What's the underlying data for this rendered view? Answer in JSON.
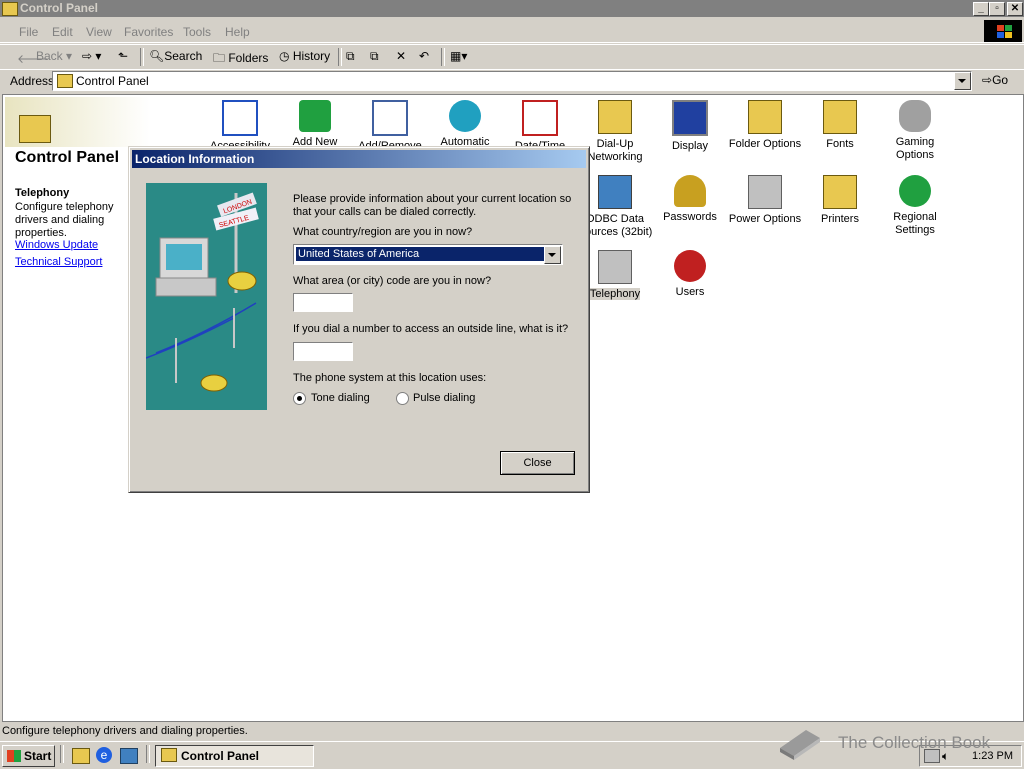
{
  "window": {
    "title": "Control Panel",
    "min": "_",
    "max": "▫",
    "close": "✕"
  },
  "menu": [
    "File",
    "Edit",
    "View",
    "Favorites",
    "Tools",
    "Help"
  ],
  "toolbar": {
    "back": "Back",
    "search": "Search",
    "folders": "Folders",
    "history": "History"
  },
  "address": {
    "label": "Address",
    "value": "Control Panel",
    "go": "Go"
  },
  "sidebar": {
    "title": "Control Panel",
    "heading": "Telephony",
    "description": "Configure telephony drivers and dialing properties.",
    "links": [
      "Windows Update",
      "Technical Support"
    ]
  },
  "icons": [
    {
      "label": "Accessibility",
      "name": "accessibility-icon",
      "color": "#2050c0"
    },
    {
      "label": "Add New",
      "name": "add-new-hardware-icon",
      "color": "#20a040"
    },
    {
      "label": "Add/Remove",
      "name": "add-remove-programs-icon",
      "color": "#4060a0"
    },
    {
      "label": "Automatic",
      "name": "automatic-updates-icon",
      "color": "#20a0c0"
    },
    {
      "label": "Date/Time",
      "name": "date-time-icon",
      "color": "#c02020"
    },
    {
      "label": "Dial-Up Networking",
      "name": "dial-up-networking-icon",
      "color": "#e8c850"
    },
    {
      "label": "Display",
      "name": "display-icon",
      "color": "#2040a0"
    },
    {
      "label": "Folder Options",
      "name": "folder-options-icon",
      "color": "#e8c850"
    },
    {
      "label": "Fonts",
      "name": "fonts-icon",
      "color": "#e8c850"
    },
    {
      "label": "Gaming Options",
      "name": "gaming-options-icon",
      "color": "#808080"
    },
    {
      "label": "ODBC Data Sources (32bit)",
      "name": "odbc-icon",
      "color": "#4080c0"
    },
    {
      "label": "Passwords",
      "name": "passwords-icon",
      "color": "#c8a020"
    },
    {
      "label": "Power Options",
      "name": "power-options-icon",
      "color": "#808080"
    },
    {
      "label": "Printers",
      "name": "printers-icon",
      "color": "#e8c850"
    },
    {
      "label": "Regional Settings",
      "name": "regional-settings-icon",
      "color": "#20a040"
    },
    {
      "label": "Telephony",
      "name": "telephony-icon",
      "color": "#808080"
    },
    {
      "label": "Users",
      "name": "users-icon",
      "color": "#c02020"
    }
  ],
  "dialog": {
    "title": "Location Information",
    "intro": "Please provide information about your current location so that your calls can be dialed correctly.",
    "country_prompt": "What country/region are you in now?",
    "country_value": "United States of America",
    "area_prompt": "What area (or city) code are you in now?",
    "area_value": "",
    "outside_prompt": "If you dial a number to access an outside line, what is it?",
    "outside_value": "",
    "system_prompt": "The phone system at this location uses:",
    "tone_label": "Tone dialing",
    "pulse_label": "Pulse dialing",
    "selected": "tone",
    "close_label": "Close",
    "sign_top": "LONDON",
    "sign_bottom": "SEATTLE"
  },
  "statusbar": "Configure telephony drivers and dialing properties.",
  "taskbar": {
    "start": "Start",
    "task": "Control Panel",
    "clock": "1:23 PM"
  },
  "watermark": "The Collection Book"
}
